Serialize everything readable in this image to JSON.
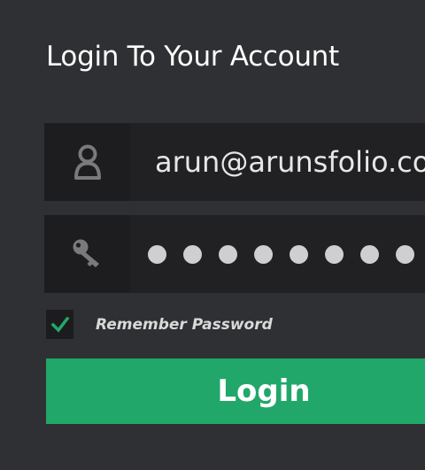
{
  "title": "Login To Your Account",
  "email": {
    "value": "arun@arunsfolio.co",
    "icon": "user-icon"
  },
  "password": {
    "icon": "key-icon",
    "masked_char": "●",
    "visible_dot_count": 8
  },
  "remember": {
    "label": "Remember Password",
    "checked": true
  },
  "login_button": {
    "label": "Login"
  },
  "colors": {
    "background": "#2f3033",
    "field": "#212124",
    "icon_box": "#1d1d20",
    "accent": "#22a76a",
    "check": "#22a76a"
  }
}
